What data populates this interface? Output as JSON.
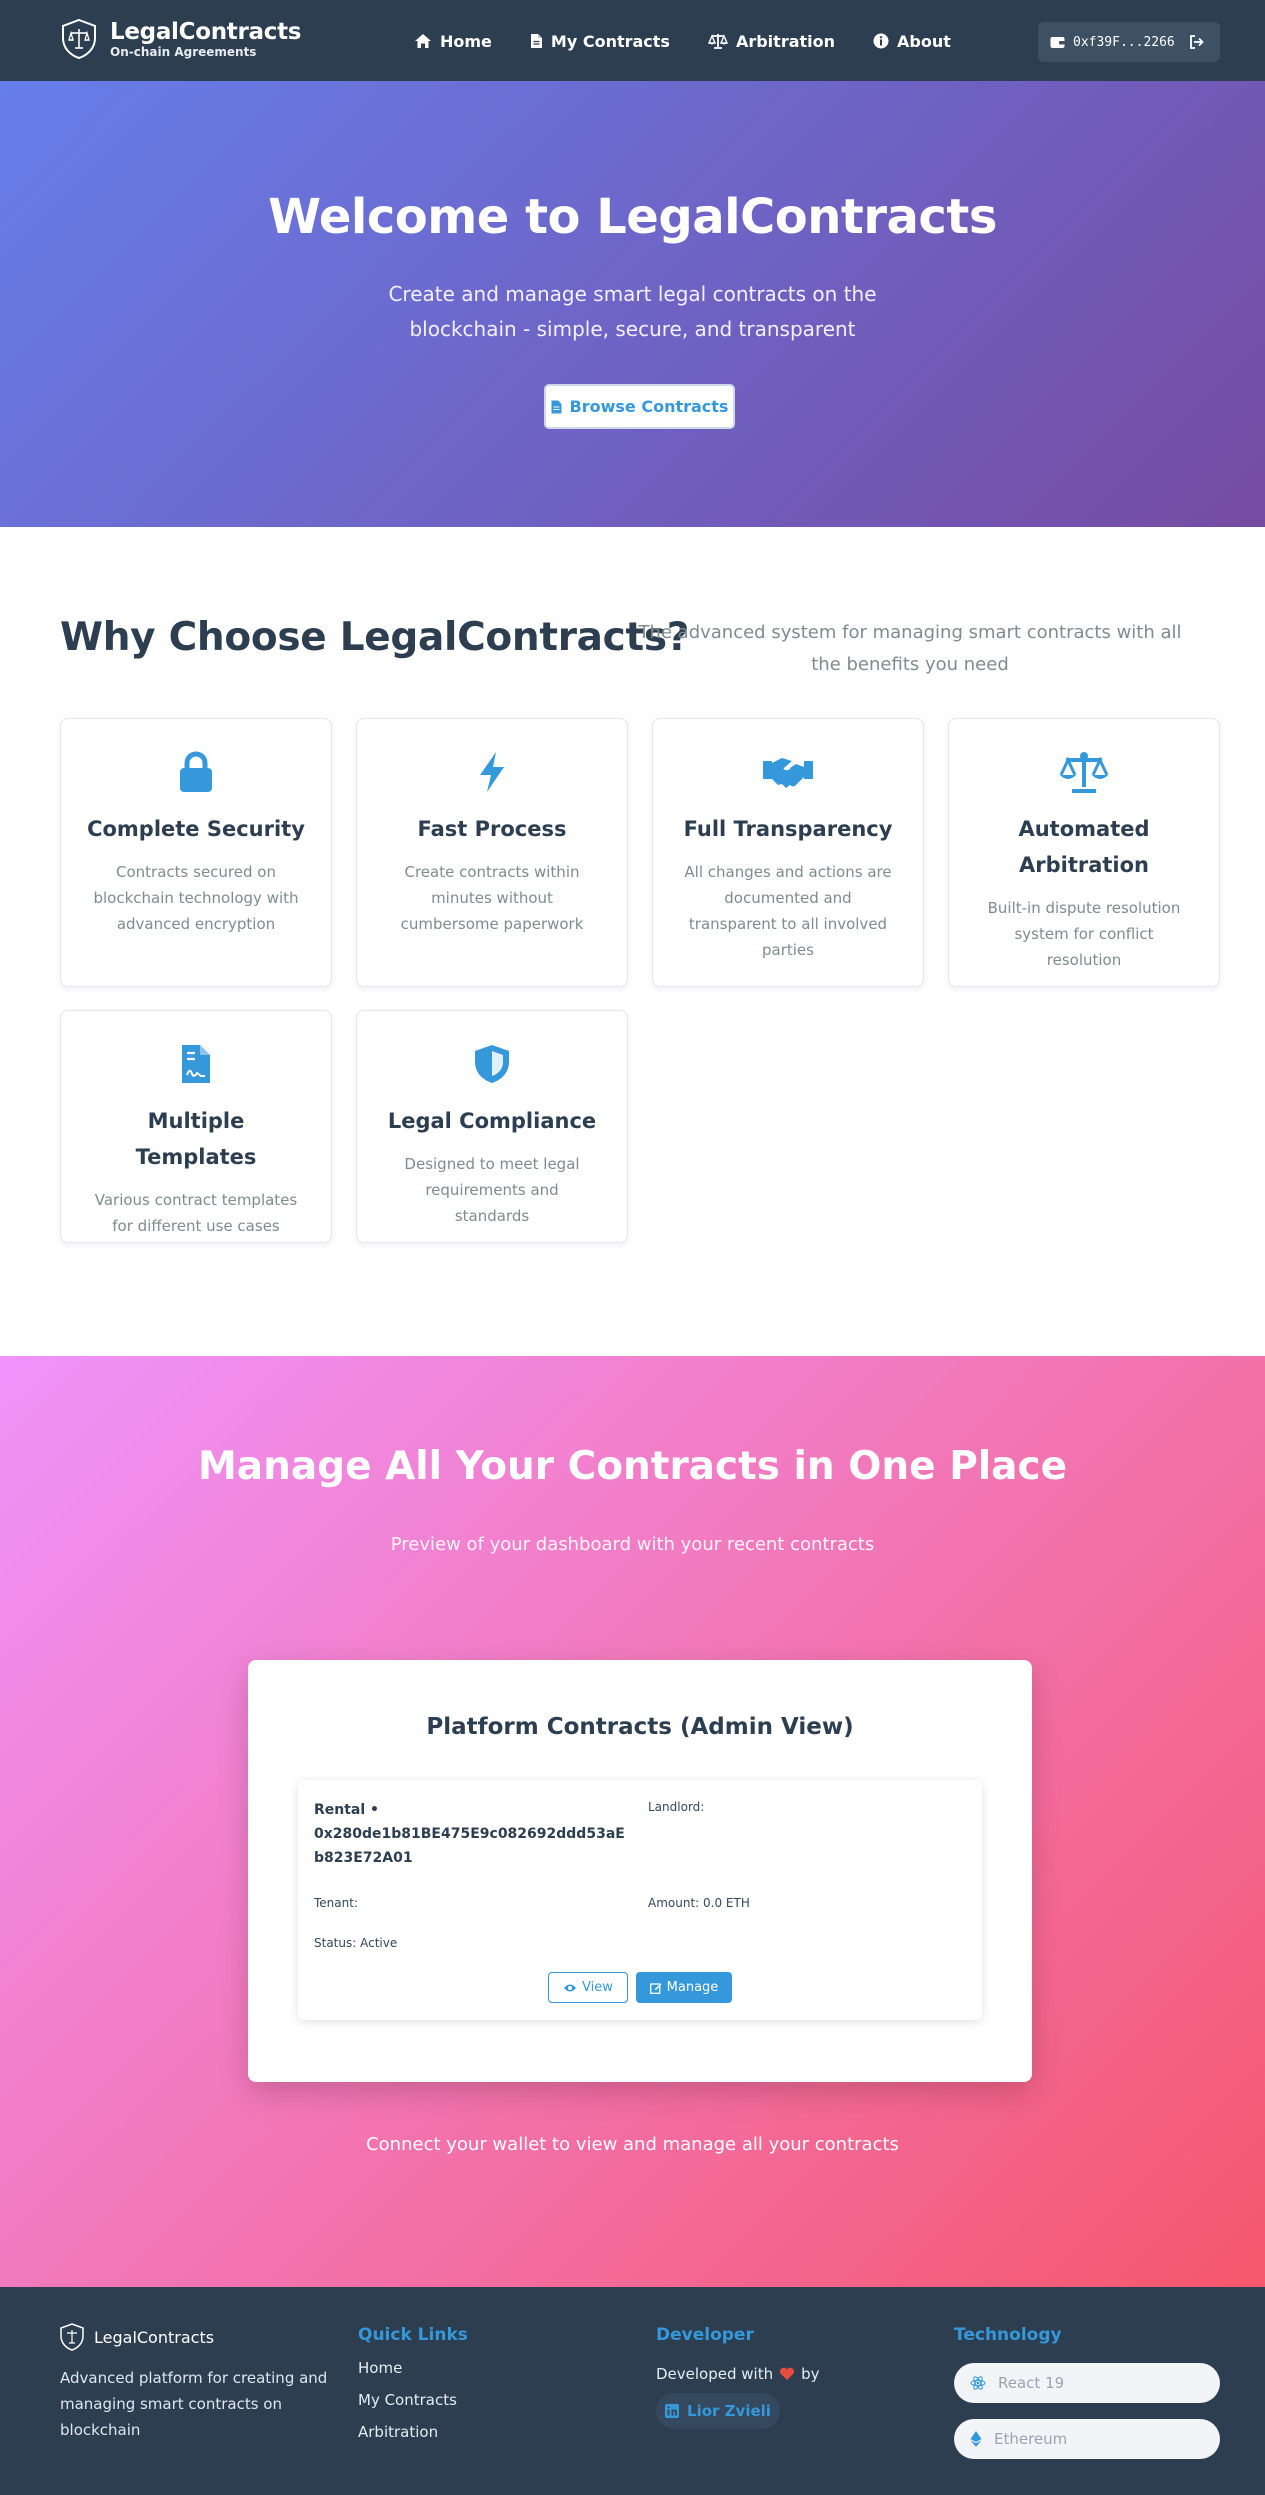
{
  "nav": {
    "brand_title": "LegalContracts",
    "brand_subtitle": "On-chain Agreements",
    "links": [
      {
        "label": "Home",
        "icon": "home-icon"
      },
      {
        "label": "My Contracts",
        "icon": "document-icon"
      },
      {
        "label": "Arbitration",
        "icon": "scale-icon"
      },
      {
        "label": "About",
        "icon": "info-icon"
      }
    ],
    "wallet_address": "0xf39F...2266"
  },
  "hero": {
    "title": "Welcome to LegalContracts",
    "subtitle": "Create and manage smart legal contracts on the blockchain - simple, secure, and transparent",
    "button_label": "Browse Contracts"
  },
  "features": {
    "title": "Why Choose LegalContracts?",
    "subtitle": "The advanced system for managing smart contracts with all the benefits you need",
    "items": [
      {
        "title": "Complete Security",
        "desc": "Contracts secured on blockchain technology with advanced encryption",
        "icon": "lock-icon"
      },
      {
        "title": "Fast Process",
        "desc": "Create contracts within minutes without cumbersome paperwork",
        "icon": "bolt-icon"
      },
      {
        "title": "Full Transparency",
        "desc": "All changes and actions are documented and transparent to all involved parties",
        "icon": "handshake-icon"
      },
      {
        "title": "Automated Arbitration",
        "desc": "Built-in dispute resolution system for conflict resolution",
        "icon": "scale-icon"
      },
      {
        "title": "Multiple Templates",
        "desc": "Various contract templates for different use cases",
        "icon": "contract-file-icon"
      },
      {
        "title": "Legal Compliance",
        "desc": "Designed to meet legal requirements and standards",
        "icon": "shield-icon"
      }
    ]
  },
  "dashboard": {
    "title": "Manage All Your Contracts in One Place",
    "subtitle": "Preview of your dashboard with your recent contracts",
    "panel_title": "Platform Contracts (Admin View)",
    "contract": {
      "type": "Rental •",
      "address": "0x280de1b81BE475E9c082692ddd53aEb823E72A01",
      "landlord": "Landlord:",
      "tenant": "Tenant:",
      "amount": "Amount: 0.0 ETH",
      "status": "Status: Active",
      "view_label": "View",
      "manage_label": "Manage"
    },
    "footer_text": "Connect your wallet to view and manage all your contracts"
  },
  "footer": {
    "brand": "LegalContracts",
    "description": "Advanced platform for creating and managing smart contracts on blockchain",
    "quick_links_title": "Quick Links",
    "quick_links": [
      "Home",
      "My Contracts",
      "Arbitration"
    ],
    "developer_title": "Developer",
    "developed_with": "Developed with",
    "by": "by",
    "developer_name": "Lior Zvieli",
    "technology_title": "Technology",
    "tech": [
      "React 19",
      "Ethereum"
    ]
  },
  "colors": {
    "nav_bg": "#2c3e50",
    "accent": "#3498db",
    "hero_gradient": [
      "#667eea",
      "#764ba2"
    ],
    "dashboard_gradient": [
      "#f093fb",
      "#f5576c"
    ],
    "heart": "#e74c3c"
  }
}
